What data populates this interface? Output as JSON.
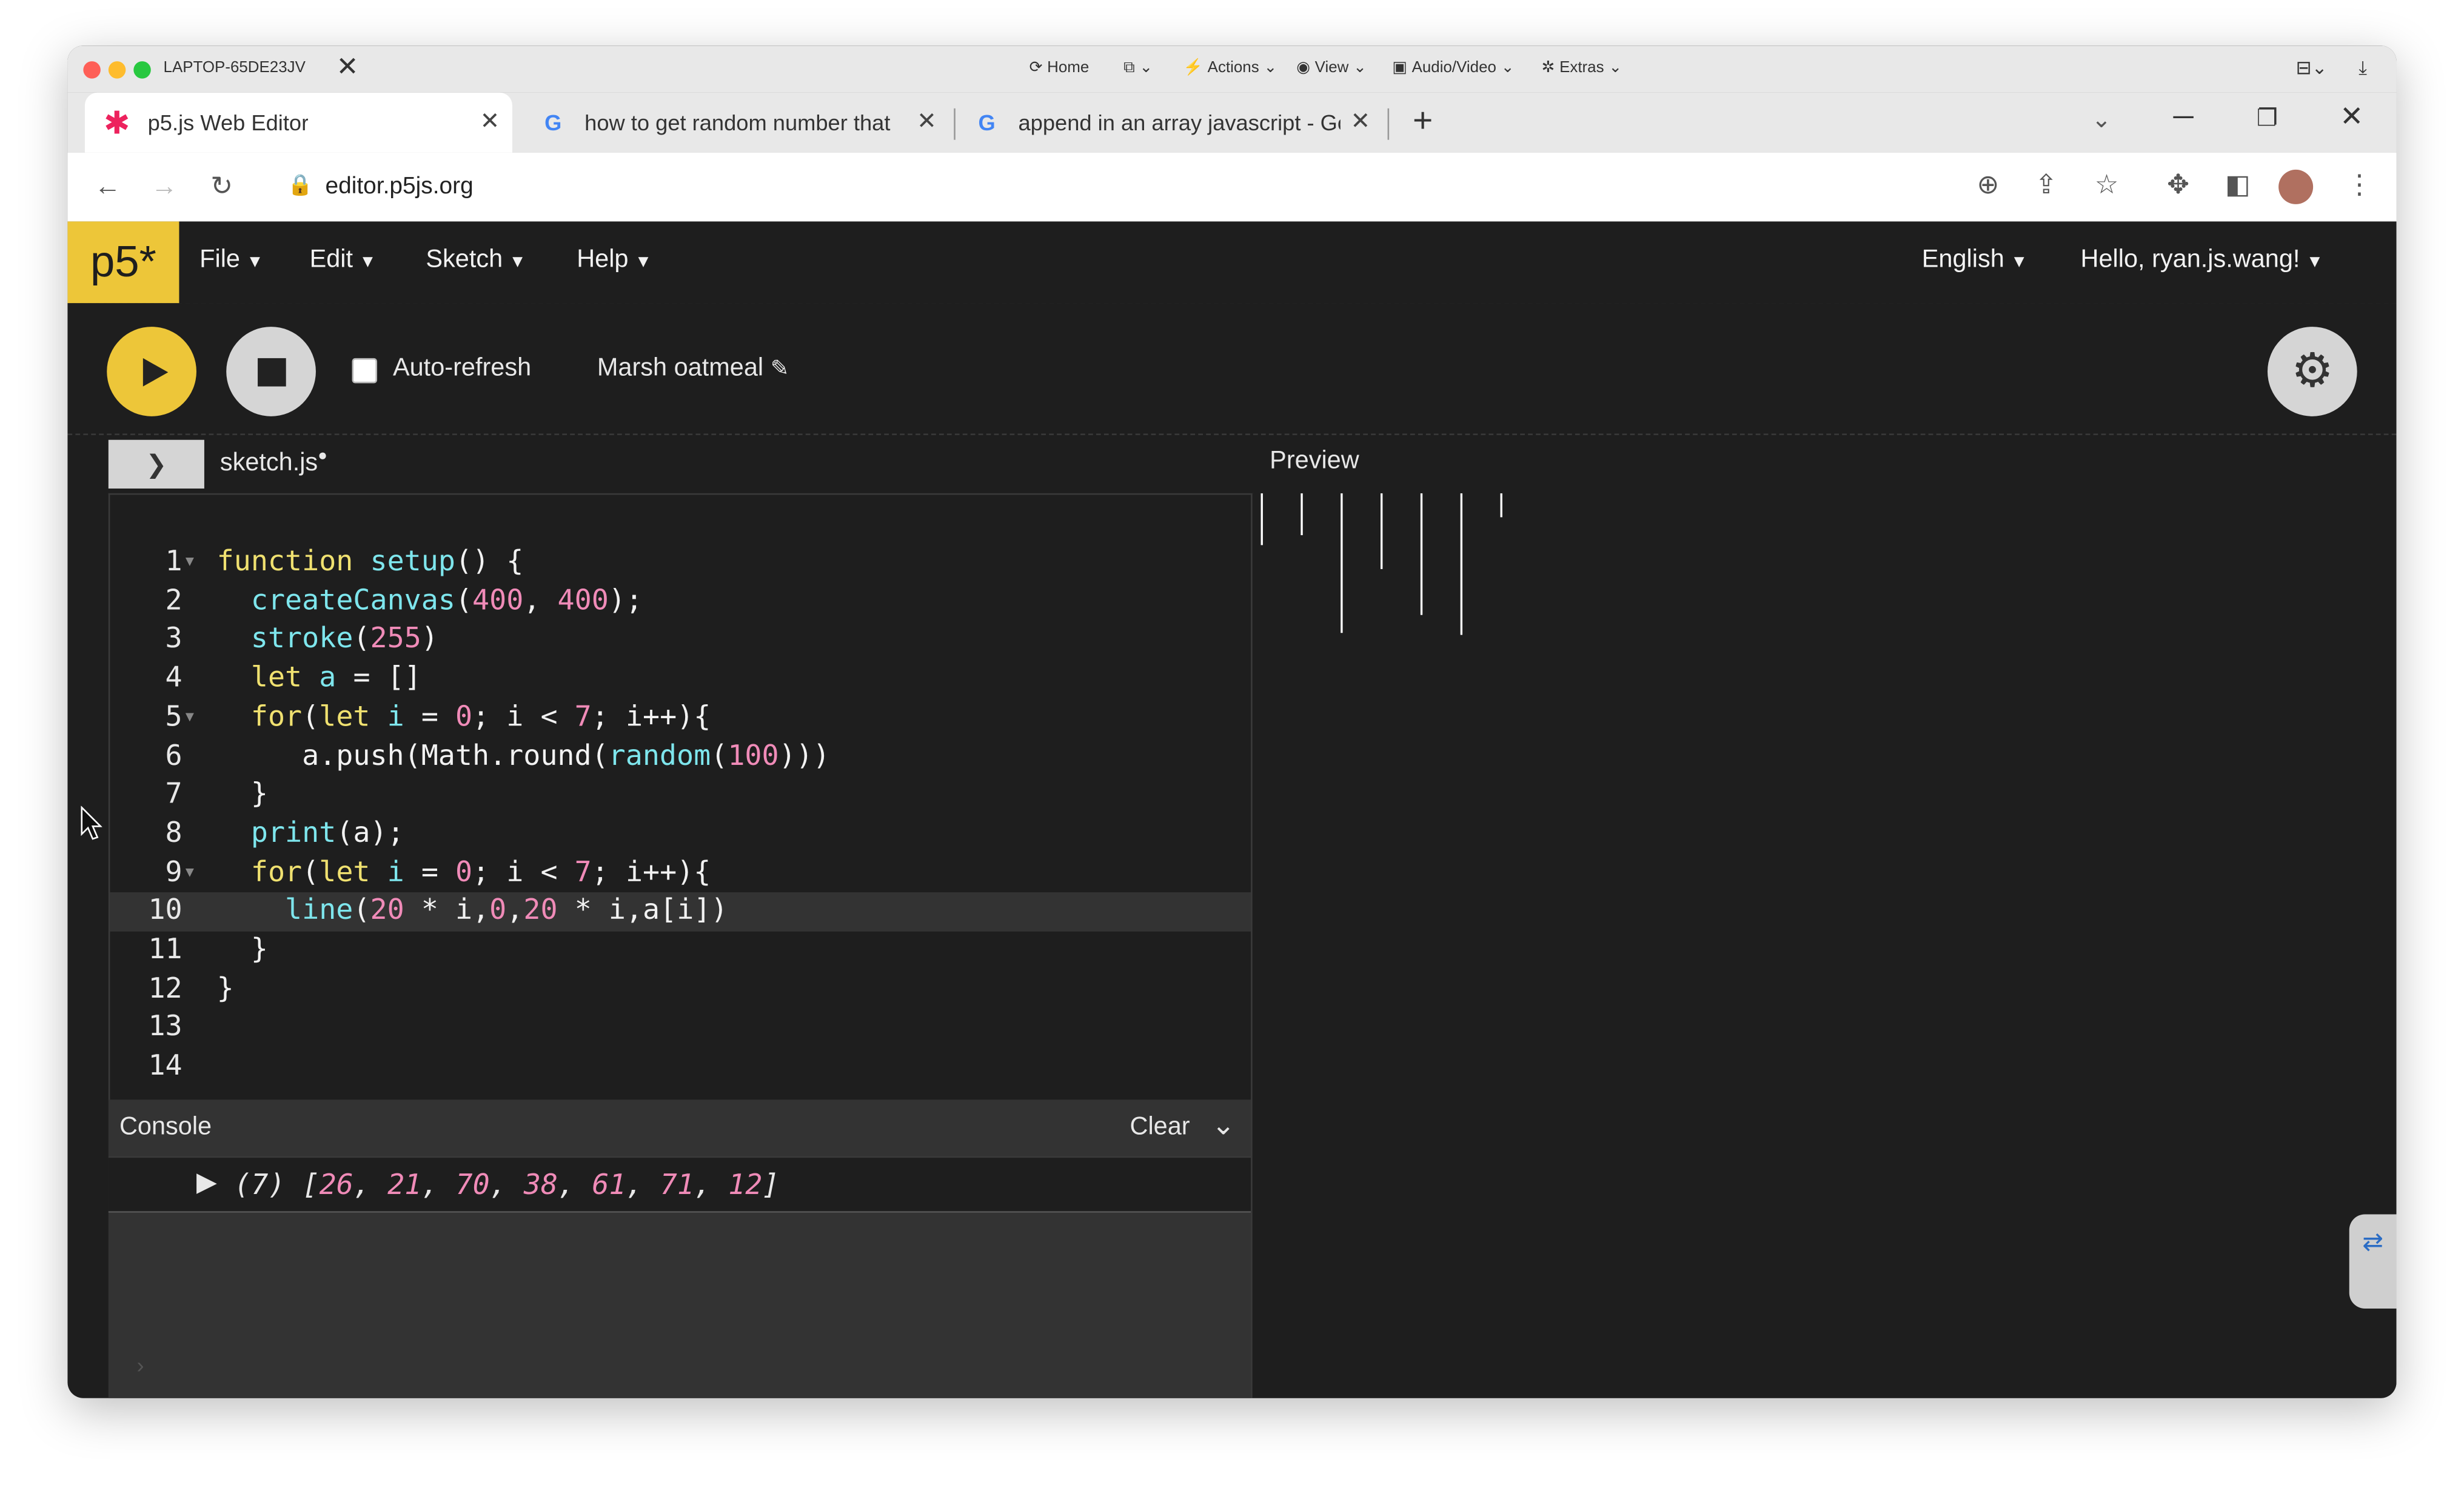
{
  "remote_bar": {
    "host": "LAPTOP-65DE23JV",
    "menus": [
      "Home",
      "",
      "Actions",
      "View",
      "Audio/Video",
      "Extras"
    ]
  },
  "tabs": [
    {
      "title": "p5.js Web Editor",
      "active": true
    },
    {
      "title": "how to get random number that",
      "active": false
    },
    {
      "title": "append in an array javascript - Go",
      "active": false
    }
  ],
  "address": {
    "url": "editor.p5js.org"
  },
  "p5": {
    "logo": "p5*",
    "menus": [
      "File",
      "Edit",
      "Sketch",
      "Help"
    ],
    "language": "English",
    "user": "Hello, ryan.js.wang!"
  },
  "toolbar": {
    "auto_refresh_label": "Auto-refresh",
    "auto_refresh_checked": false,
    "project_name": "Marsh oatmeal"
  },
  "editor": {
    "file_name": "sketch.js",
    "current_line": 10,
    "line_numbers": [
      "1",
      "2",
      "3",
      "4",
      "5",
      "6",
      "7",
      "8",
      "9",
      "10",
      "11",
      "12",
      "13",
      "14"
    ],
    "code_lines": [
      "function setup() {",
      "  createCanvas(400, 400);",
      "  stroke(255)",
      "  let a = []",
      "  for(let i = 0; i < 7; i++){",
      "     a.push(Math.round(random(100)))",
      "  }",
      "  print(a);",
      "  for(let i = 0; i < 7; i++){",
      "    line(20 * i,0,20 * i,a[i])",
      "  }",
      "}",
      "",
      ""
    ]
  },
  "console": {
    "title": "Console",
    "clear_label": "Clear",
    "output_count": "(7)",
    "output_values": [
      26,
      21,
      70,
      38,
      61,
      71,
      12
    ]
  },
  "preview": {
    "title": "Preview"
  },
  "colors": {
    "p5_yellow": "#edc639",
    "editor_bg": "#1e1e1e",
    "keyword": "#f0e170",
    "function": "#7ee6ed",
    "number": "#f08bb8"
  }
}
